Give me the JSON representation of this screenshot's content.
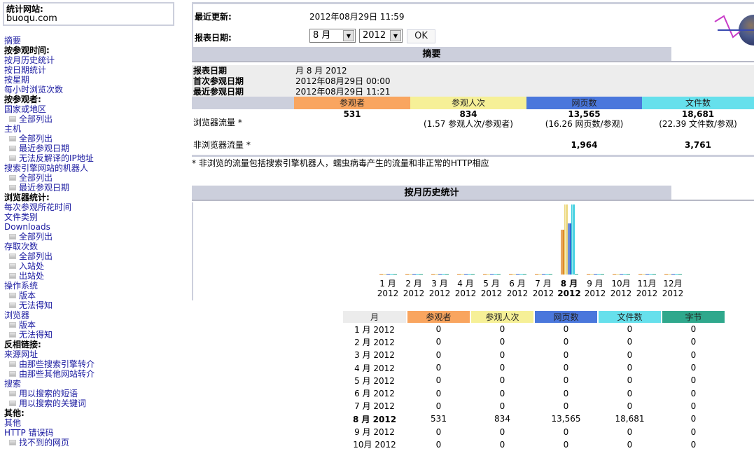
{
  "site": {
    "label": "统计网站:",
    "domain": "buoqu.com"
  },
  "sidebar": [
    {
      "type": "link",
      "label": "摘要"
    },
    {
      "type": "head",
      "label": "按参观时间:"
    },
    {
      "type": "link",
      "label": "按月历史统计"
    },
    {
      "type": "link",
      "label": "按日期统计"
    },
    {
      "type": "link",
      "label": "按星期"
    },
    {
      "type": "link",
      "label": "每小时浏览次数"
    },
    {
      "type": "head",
      "label": "按参观者:"
    },
    {
      "type": "link",
      "label": "国家或地区"
    },
    {
      "type": "sub",
      "label": "全部列出"
    },
    {
      "type": "link",
      "label": "主机"
    },
    {
      "type": "sub",
      "label": "全部列出"
    },
    {
      "type": "sub",
      "label": "最近参观日期"
    },
    {
      "type": "sub",
      "label": "无法反解译的IP地址"
    },
    {
      "type": "link",
      "label": "搜索引擎网站的机器人"
    },
    {
      "type": "sub",
      "label": "全部列出"
    },
    {
      "type": "sub",
      "label": "最近参观日期"
    },
    {
      "type": "head",
      "label": "浏览器统计:"
    },
    {
      "type": "link",
      "label": "每次参观所花时间"
    },
    {
      "type": "link",
      "label": "文件类别"
    },
    {
      "type": "link",
      "label": "Downloads"
    },
    {
      "type": "sub",
      "label": "全部列出"
    },
    {
      "type": "link",
      "label": "存取次数"
    },
    {
      "type": "sub",
      "label": "全部列出"
    },
    {
      "type": "sub",
      "label": "入站处"
    },
    {
      "type": "sub",
      "label": "出站处"
    },
    {
      "type": "link",
      "label": "操作系统"
    },
    {
      "type": "sub",
      "label": "版本"
    },
    {
      "type": "sub",
      "label": "无法得知"
    },
    {
      "type": "link",
      "label": "浏览器"
    },
    {
      "type": "sub",
      "label": "版本"
    },
    {
      "type": "sub",
      "label": "无法得知"
    },
    {
      "type": "head",
      "label": "反相链接:"
    },
    {
      "type": "link",
      "label": "来源网址"
    },
    {
      "type": "sub",
      "label": "由那些搜索引擎转介"
    },
    {
      "type": "sub",
      "label": "由那些其他网站转介"
    },
    {
      "type": "link",
      "label": "搜索"
    },
    {
      "type": "sub",
      "label": "用以搜索的短语"
    },
    {
      "type": "sub",
      "label": "用以搜索的关键词"
    },
    {
      "type": "head",
      "label": "其他:"
    },
    {
      "type": "link",
      "label": "其他"
    },
    {
      "type": "link",
      "label": "HTTP 错误码"
    },
    {
      "type": "sub",
      "label": "找不到的网页"
    }
  ],
  "header": {
    "last_update_label": "最近更新:",
    "last_update_value": "2012年08月29日 11:59",
    "report_date_label": "报表日期:",
    "month_select": "8 月",
    "year_select": "2012",
    "ok_label": "OK",
    "logo_icon": "awstats-logo-icon"
  },
  "summary": {
    "title": "摘要",
    "rows": [
      {
        "label": "报表日期",
        "value": "月 8 月 2012"
      },
      {
        "label": "首次参观日期",
        "value": "2012年08月29日 00:00"
      },
      {
        "label": "最近参观日期",
        "value": "2012年08月29日 11:21"
      }
    ],
    "columns": [
      "参观者",
      "参观人次",
      "网页数",
      "文件数"
    ],
    "browser_traffic": {
      "label": "浏览器流量 *",
      "visitors": "531",
      "visits": "834",
      "visits_sub": "(1.57 参观人次/参观者)",
      "pages": "13,565",
      "pages_sub": "(16.26 网页数/参观)",
      "files": "18,681",
      "files_sub": "(22.39 文件数/参观)"
    },
    "non_browser_traffic": {
      "label": "非浏览器流量 *",
      "pages": "1,964",
      "files": "3,761"
    },
    "footnote": "* 非浏览的流量包括搜索引擎机器人，蠕虫病毒产生的流量和非正常的HTTP相应"
  },
  "colors": {
    "visitors": "#f9a55f",
    "visits": "#f6f097",
    "pages": "#4a77dc",
    "files": "#66e0ec",
    "bytes": "#2fa88c",
    "header_bg": "#cccfdc"
  },
  "monthly": {
    "title": "按月历史统计",
    "columns": [
      "月",
      "参观者",
      "参观人次",
      "网页数",
      "文件数",
      "字节"
    ],
    "rows": [
      [
        "1 月 2012",
        "0",
        "0",
        "0",
        "0",
        "0"
      ],
      [
        "2 月 2012",
        "0",
        "0",
        "0",
        "0",
        "0"
      ],
      [
        "3 月 2012",
        "0",
        "0",
        "0",
        "0",
        "0"
      ],
      [
        "4 月 2012",
        "0",
        "0",
        "0",
        "0",
        "0"
      ],
      [
        "5 月 2012",
        "0",
        "0",
        "0",
        "0",
        "0"
      ],
      [
        "6 月 2012",
        "0",
        "0",
        "0",
        "0",
        "0"
      ],
      [
        "7 月 2012",
        "0",
        "0",
        "0",
        "0",
        "0"
      ],
      [
        "8 月 2012",
        "531",
        "834",
        "13,565",
        "18,681",
        "0"
      ],
      [
        "9 月 2012",
        "0",
        "0",
        "0",
        "0",
        "0"
      ],
      [
        "10月 2012",
        "0",
        "0",
        "0",
        "0",
        "0"
      ]
    ],
    "current_row": 7
  },
  "chart_data": {
    "type": "bar",
    "title": "按月历史统计",
    "categories": [
      "1 月\n2012",
      "2 月\n2012",
      "3 月\n2012",
      "4 月\n2012",
      "5 月\n2012",
      "6 月\n2012",
      "7 月\n2012",
      "8 月\n2012",
      "9 月\n2012",
      "10月\n2012",
      "11月\n2012",
      "12月\n2012"
    ],
    "month_labels": [
      "1 月",
      "2 月",
      "3 月",
      "4 月",
      "5 月",
      "6 月",
      "7 月",
      "8 月",
      "9 月",
      "10月",
      "11月",
      "12月"
    ],
    "year_label": "2012",
    "highlight_index": 7,
    "series": [
      {
        "name": "参观者",
        "color": "#e08a28",
        "values": [
          0,
          0,
          0,
          0,
          0,
          0,
          0,
          531,
          0,
          0,
          0,
          0
        ],
        "max": 834
      },
      {
        "name": "参观人次",
        "color": "#ecd87f",
        "values": [
          0,
          0,
          0,
          0,
          0,
          0,
          0,
          834,
          0,
          0,
          0,
          0
        ],
        "max": 834
      },
      {
        "name": "网页数",
        "color": "#3a66d0",
        "values": [
          0,
          0,
          0,
          0,
          0,
          0,
          0,
          13565,
          0,
          0,
          0,
          0
        ],
        "max": 18681
      },
      {
        "name": "文件数",
        "color": "#3fd0e0",
        "values": [
          0,
          0,
          0,
          0,
          0,
          0,
          0,
          18681,
          0,
          0,
          0,
          0
        ],
        "max": 18681
      },
      {
        "name": "字节",
        "color": "#2fa88c",
        "values": [
          0,
          0,
          0,
          0,
          0,
          0,
          0,
          0,
          0,
          0,
          0,
          0
        ],
        "max": 1
      }
    ]
  }
}
